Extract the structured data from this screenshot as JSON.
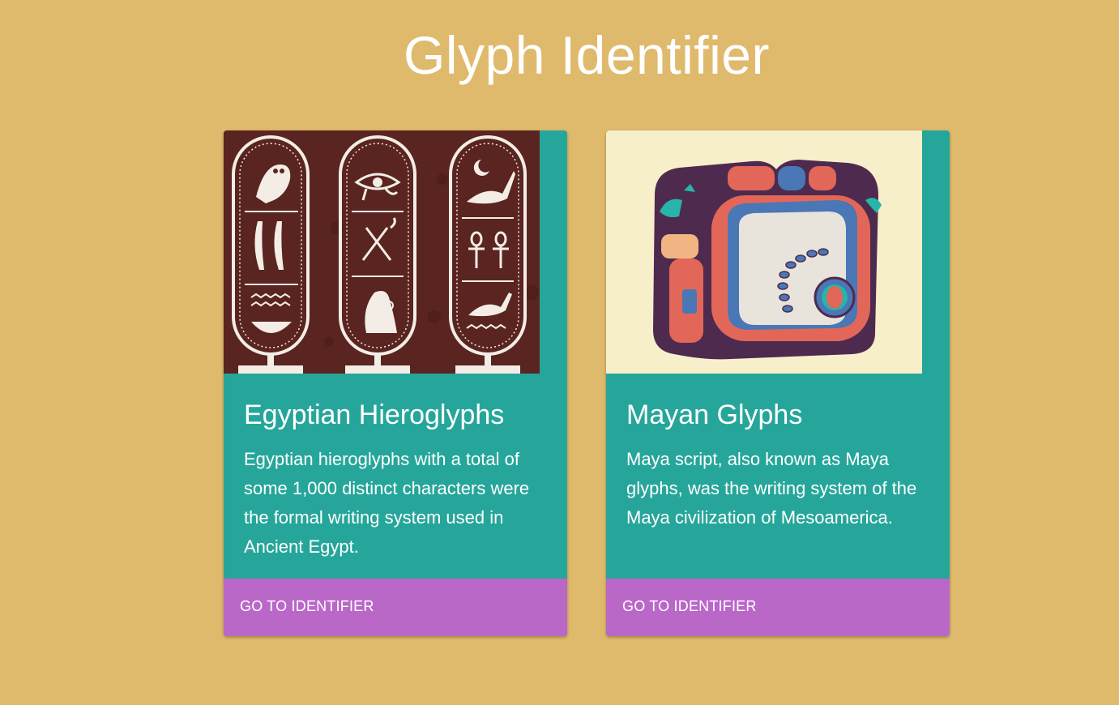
{
  "page": {
    "title": "Glyph Identifier"
  },
  "cards": [
    {
      "title": "Egyptian Hieroglyphs",
      "description": "Egyptian hieroglyphs with a total of some 1,000 distinct characters were the formal writing system used in Ancient Egypt.",
      "action_label": "GO TO IDENTIFIER",
      "image": "egyptian-cartouche-illustration"
    },
    {
      "title": "Mayan Glyphs",
      "description": "Maya script, also known as Maya glyphs, was the writing system of the Maya civilization of Mesoamerica.",
      "action_label": "GO TO IDENTIFIER",
      "image": "mayan-glyph-illustration"
    }
  ],
  "colors": {
    "background": "#dfba6c",
    "card": "#26a69a",
    "action": "#ba68c8",
    "text": "#ffffff"
  }
}
